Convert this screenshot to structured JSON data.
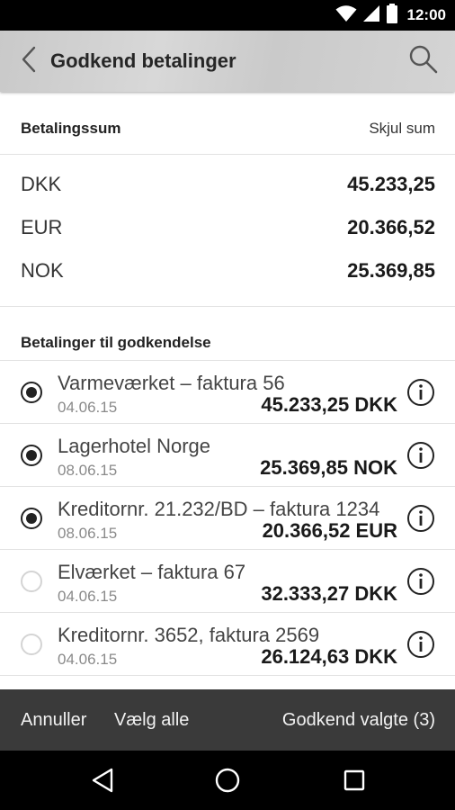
{
  "status_bar": {
    "time": "12:00"
  },
  "app_bar": {
    "title": "Godkend betalinger"
  },
  "sum_section": {
    "label": "Betalingssum",
    "toggle_label": "Skjul sum",
    "rows": [
      {
        "currency": "DKK",
        "amount": "45.233,25"
      },
      {
        "currency": "EUR",
        "amount": "20.366,52"
      },
      {
        "currency": "NOK",
        "amount": "25.369,85"
      }
    ]
  },
  "list_section": {
    "label": "Betalinger til godkendelse",
    "items": [
      {
        "name": "Varmeværket – faktura 56",
        "date": "04.06.15",
        "amount": "45.233,25 DKK",
        "selected": true
      },
      {
        "name": "Lagerhotel Norge",
        "date": "08.06.15",
        "amount": "25.369,85 NOK",
        "selected": true
      },
      {
        "name": "Kreditornr. 21.232/BD – faktura 1234",
        "date": "08.06.15",
        "amount": "20.366,52 EUR",
        "selected": true
      },
      {
        "name": "Elværket – faktura 67",
        "date": "04.06.15",
        "amount": "32.333,27 DKK",
        "selected": false
      },
      {
        "name": "Kreditornr. 3652, faktura 2569",
        "date": "04.06.15",
        "amount": "26.124,63 DKK",
        "selected": false
      }
    ]
  },
  "footer": {
    "cancel_label": "Annuller",
    "select_all_label": "Vælg alle",
    "approve_label": "Godkend valgte (3)"
  },
  "icons": [
    "wifi-icon",
    "signal-icon",
    "battery-icon",
    "back-arrow-icon",
    "search-icon",
    "radio-icon",
    "info-icon",
    "nav-back-icon",
    "nav-home-icon",
    "nav-recents-icon"
  ]
}
